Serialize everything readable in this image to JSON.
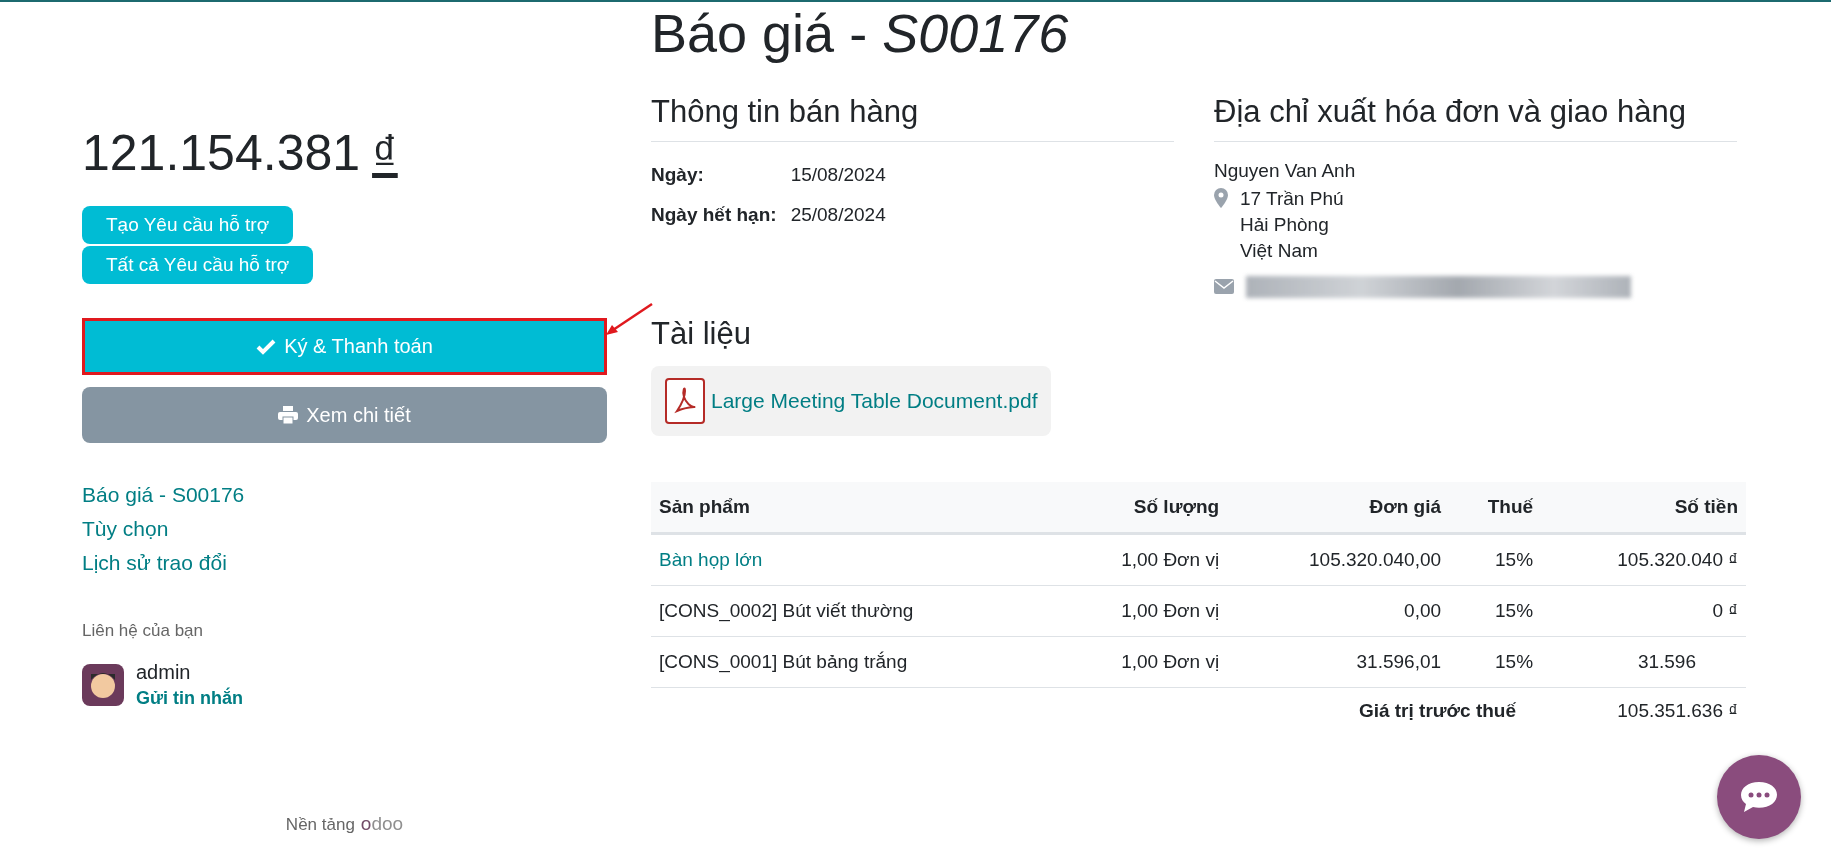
{
  "title": {
    "text": "Báo giá - ",
    "number": "S00176"
  },
  "sidebar": {
    "amount": "121.154.381",
    "currency": "₫",
    "tag_buttons": [
      "Tạo Yêu cầu hỗ trợ",
      "Tất cả Yêu cầu hỗ trợ"
    ],
    "sign_button": {
      "label": "Ký & Thanh toán",
      "highlighted": true
    },
    "view_button": {
      "label": "Xem chi tiết"
    },
    "nav_links": [
      "Báo giá - S00176",
      "Tùy chọn",
      "Lịch sử trao đổi"
    ],
    "contact": {
      "heading": "Liên hệ của bạn",
      "name": "admin",
      "action": "Gửi tin nhắn"
    },
    "footer": {
      "text": "Nền tảng",
      "logo": "odoo"
    }
  },
  "sales_info": {
    "heading": "Thông tin bán hàng",
    "fields": [
      {
        "label": "Ngày:",
        "value": "15/08/2024"
      },
      {
        "label": "Ngày hết hạn:",
        "value": "25/08/2024"
      }
    ]
  },
  "address": {
    "heading": "Địa chỉ xuất hóa đơn và giao hàng",
    "name": "Nguyen Van Anh",
    "lines": [
      "17 Trần Phú",
      "Hải Phòng",
      "Việt Nam"
    ]
  },
  "documents": {
    "heading": "Tài liệu",
    "files": [
      {
        "name": "Large Meeting Table Document.pdf"
      }
    ]
  },
  "table": {
    "columns": [
      "Sản phẩm",
      "Số lượng",
      "Đơn giá",
      "Thuế",
      "Số tiền"
    ],
    "rows": [
      {
        "kind": "link",
        "cells": [
          "Bàn họp lớn",
          "1,00 Đơn vị",
          "105.320.040,00",
          "15%",
          "105.320.040 ₫"
        ]
      },
      {
        "kind": "plain",
        "cells": [
          "[CONS_0002] Bút viết thường",
          "1,00 Đơn vị",
          "0,00",
          "15%",
          "0 ₫"
        ]
      },
      {
        "kind": "plain",
        "cells": [
          "[CONS_0001] Bút bảng trắng",
          "1,00 Đơn vị",
          "31.596,01",
          "15%",
          "31.596"
        ]
      }
    ]
  },
  "totals": [
    {
      "label": "Giá trị trước thuế",
      "value": "105.351.636 ₫"
    }
  ]
}
